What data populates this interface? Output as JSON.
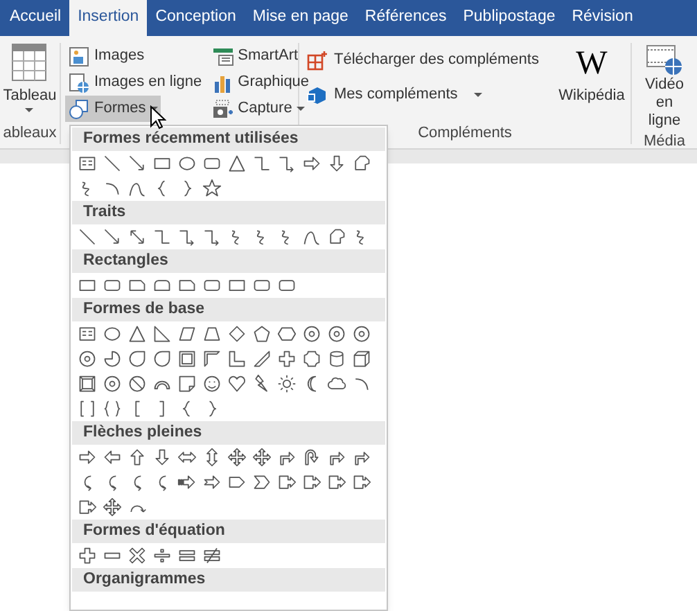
{
  "tabs": [
    {
      "label": "Accueil",
      "selected": false
    },
    {
      "label": "Insertion",
      "selected": true
    },
    {
      "label": "Conception",
      "selected": false
    },
    {
      "label": "Mise en page",
      "selected": false
    },
    {
      "label": "Références",
      "selected": false
    },
    {
      "label": "Publipostage",
      "selected": false
    },
    {
      "label": "Révision",
      "selected": false
    }
  ],
  "ribbon": {
    "table_group": {
      "button": "Tableau",
      "label": "ableaux"
    },
    "illustrations": [
      {
        "label": "Images",
        "kind": "images",
        "menu": false,
        "selected": false
      },
      {
        "label": "Images en ligne",
        "kind": "online-images",
        "menu": false,
        "selected": false
      },
      {
        "label": "Formes",
        "kind": "shapes",
        "menu": true,
        "selected": true
      },
      {
        "label": "SmartArt",
        "kind": "smartart",
        "menu": false,
        "selected": false
      },
      {
        "label": "Graphique",
        "kind": "chart",
        "menu": false,
        "selected": false
      },
      {
        "label": "Capture",
        "kind": "capture",
        "menu": true,
        "selected": false
      }
    ],
    "complements": {
      "items": [
        {
          "label": "Télécharger des compléments",
          "kind": "store",
          "menu": false
        },
        {
          "label": "Mes compléments",
          "kind": "addins",
          "menu": true
        }
      ],
      "big": {
        "label": "Wikipédia",
        "icon_text": "W"
      },
      "label": "Compléments"
    },
    "media": {
      "button": "Vidéo en ligne",
      "label": "Média"
    }
  },
  "shapes_menu": [
    {
      "title": "Formes récemment utilisées",
      "shapes": [
        {
          "kind": "text-box"
        },
        {
          "kind": "line"
        },
        {
          "kind": "arrow-line"
        },
        {
          "kind": "rect"
        },
        {
          "kind": "ellipse"
        },
        {
          "kind": "rounded-rect"
        },
        {
          "kind": "triangle"
        },
        {
          "kind": "elbow"
        },
        {
          "kind": "elbow-arrow"
        },
        {
          "kind": "right-arrow"
        },
        {
          "kind": "down-arrow"
        },
        {
          "kind": "freeform"
        },
        {
          "kind": "scribble"
        },
        {
          "kind": "arc"
        },
        {
          "kind": "curve"
        },
        {
          "kind": "left-brace"
        },
        {
          "kind": "right-brace"
        },
        {
          "kind": "star"
        }
      ]
    },
    {
      "title": "Traits",
      "shapes": [
        {
          "kind": "line"
        },
        {
          "kind": "arrow-line"
        },
        {
          "kind": "double-arrow-line"
        },
        {
          "kind": "elbow"
        },
        {
          "kind": "elbow-arrow"
        },
        {
          "kind": "elbow-arrow"
        },
        {
          "kind": "scribble"
        },
        {
          "kind": "scribble"
        },
        {
          "kind": "scribble"
        },
        {
          "kind": "curve"
        },
        {
          "kind": "freeform"
        },
        {
          "kind": "scribble"
        }
      ]
    },
    {
      "title": "Rectangles",
      "shapes": [
        {
          "kind": "rect"
        },
        {
          "kind": "rounded-rect"
        },
        {
          "kind": "snip-rect"
        },
        {
          "kind": "round-top-rect"
        },
        {
          "kind": "snip-rect"
        },
        {
          "kind": "rounded-rect"
        },
        {
          "kind": "rect"
        },
        {
          "kind": "rounded-rect"
        },
        {
          "kind": "rounded-rect"
        }
      ]
    },
    {
      "title": "Formes de base",
      "shapes": [
        {
          "kind": "text-box"
        },
        {
          "kind": "ellipse"
        },
        {
          "kind": "triangle"
        },
        {
          "kind": "right-triangle"
        },
        {
          "kind": "parallelogram"
        },
        {
          "kind": "trapezoid"
        },
        {
          "kind": "diamond"
        },
        {
          "kind": "pentagon"
        },
        {
          "kind": "hexagon"
        },
        {
          "kind": "ring"
        },
        {
          "kind": "ring"
        },
        {
          "kind": "ring"
        },
        {
          "kind": "ring"
        },
        {
          "kind": "pie"
        },
        {
          "kind": "teardrop"
        },
        {
          "kind": "teardrop"
        },
        {
          "kind": "frame"
        },
        {
          "kind": "half-frame"
        },
        {
          "kind": "l-shape"
        },
        {
          "kind": "diagonal-stripe"
        },
        {
          "kind": "plus"
        },
        {
          "kind": "plaque"
        },
        {
          "kind": "can"
        },
        {
          "kind": "cube"
        },
        {
          "kind": "bevel"
        },
        {
          "kind": "ring"
        },
        {
          "kind": "no-symbol"
        },
        {
          "kind": "block-arc"
        },
        {
          "kind": "folded-corner"
        },
        {
          "kind": "smiley"
        },
        {
          "kind": "heart"
        },
        {
          "kind": "lightning"
        },
        {
          "kind": "sun"
        },
        {
          "kind": "moon"
        },
        {
          "kind": "cloud"
        },
        {
          "kind": "arc"
        },
        {
          "kind": "double-bracket"
        },
        {
          "kind": "double-brace"
        },
        {
          "kind": "left-bracket"
        },
        {
          "kind": "right-bracket"
        },
        {
          "kind": "left-brace"
        },
        {
          "kind": "right-brace"
        }
      ]
    },
    {
      "title": "Flèches pleines",
      "shapes": [
        {
          "kind": "right-arrow"
        },
        {
          "kind": "left-arrow"
        },
        {
          "kind": "up-arrow"
        },
        {
          "kind": "down-arrow"
        },
        {
          "kind": "left-right-arrow"
        },
        {
          "kind": "up-down-arrow"
        },
        {
          "kind": "quad-arrow"
        },
        {
          "kind": "quad-arrow"
        },
        {
          "kind": "bent-arrow"
        },
        {
          "kind": "u-turn-arrow"
        },
        {
          "kind": "bent-arrow"
        },
        {
          "kind": "bent-arrow"
        },
        {
          "kind": "curved-arrow"
        },
        {
          "kind": "curved-arrow"
        },
        {
          "kind": "curved-arrow"
        },
        {
          "kind": "curved-arrow"
        },
        {
          "kind": "striped-arrow"
        },
        {
          "kind": "notched-arrow"
        },
        {
          "kind": "pentagon-arrow"
        },
        {
          "kind": "chevron"
        },
        {
          "kind": "callout-arrow"
        },
        {
          "kind": "callout-arrow"
        },
        {
          "kind": "callout-arrow"
        },
        {
          "kind": "callout-arrow"
        },
        {
          "kind": "callout-arrow"
        },
        {
          "kind": "quad-arrow"
        },
        {
          "kind": "circular-arrow"
        }
      ]
    },
    {
      "title": "Formes d'équation",
      "shapes": [
        {
          "kind": "plus"
        },
        {
          "kind": "minus"
        },
        {
          "kind": "multiply"
        },
        {
          "kind": "divide"
        },
        {
          "kind": "equal"
        },
        {
          "kind": "not-equal"
        }
      ]
    },
    {
      "title": "Organigrammes"
    }
  ]
}
